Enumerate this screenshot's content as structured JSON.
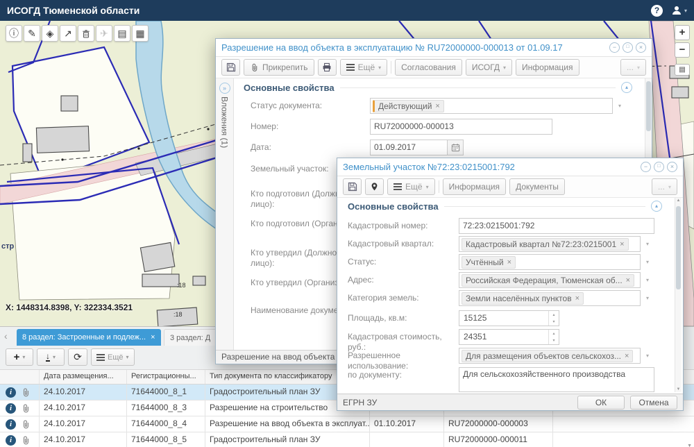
{
  "colors": {
    "topbar_bg": "#1e3c5c",
    "accent_blue": "#3e9bd6",
    "dialog_title_blue": "#4191c9",
    "selected_row": "#d2e9f8",
    "status_tag_accent": "#e9a13c"
  },
  "glyphs": {
    "help": "?",
    "chevron_down": "▾",
    "chevron_up": "▴",
    "chevron_left": "‹",
    "minimize": "−",
    "maximize": "□",
    "close": "×",
    "plus": "+",
    "down_arrow": "↓",
    "refresh": "⟳",
    "spin_up": "▴",
    "spin_down": "▾",
    "scroll_up": "▲",
    "scroll_down": "▼",
    "expand_right": "»",
    "info_letter": "i"
  },
  "app": {
    "title": "ИСОГД Тюменской области"
  },
  "map": {
    "coordinates": "X: 1448314.8398, Y: 322334.3521",
    "labels": {
      "parcel_a": ":18",
      "parcel_b": ":18",
      "street": "стр"
    },
    "zoom_in": "+",
    "zoom_out": "−",
    "basemap_glyph": "▤"
  },
  "map_toolbar": {
    "icons": [
      {
        "name": "info",
        "glyph": "ⓘ"
      },
      {
        "name": "edit",
        "glyph": "✎"
      },
      {
        "name": "geometry",
        "glyph": "◈"
      },
      {
        "name": "export",
        "glyph": "↗"
      },
      {
        "name": "measure",
        "glyph": "✈"
      },
      {
        "name": "layers",
        "glyph": "▤"
      },
      {
        "name": "legend",
        "glyph": "▦"
      }
    ]
  },
  "dialog1": {
    "title": "Разрешение на ввод объекта в эксплуатацию № RU72000000-000013 от 01.09.17",
    "toolbar": {
      "attach": "Прикрепить",
      "more": "Ещё",
      "approvals": "Согласования",
      "isogd": "ИСОГД",
      "info": "Информация",
      "overflow": "..."
    },
    "attachments_tab": "Вложения (1)",
    "section_title": "Основные свойства",
    "fields": {
      "status": {
        "label": "Статус документа:",
        "tag": "Действующий"
      },
      "number": {
        "label": "Номер:",
        "value": "RU72000000-000013"
      },
      "date": {
        "label": "Дата:",
        "value": "01.09.2017"
      },
      "parcel": {
        "label": "Земельный участок:"
      },
      "prepared_by_person": {
        "label": "Кто подготовил (Должностное лицо):"
      },
      "prepared_by_org": {
        "label": "Кто подготовил (Организация):"
      },
      "approved_by_person": {
        "label": "Кто утвердил (Должностное лицо):"
      },
      "approved_by_org": {
        "label": "Кто утвердил (Организация):"
      },
      "doc_name": {
        "label": "Наименование документа:"
      }
    },
    "status_bar": "Разрешение на ввод объекта в эксплуатацию"
  },
  "dialog2": {
    "title": "Земельный участок №72:23:0215001:792",
    "toolbar": {
      "more": "Ещё",
      "info": "Информация",
      "documents": "Документы",
      "overflow": "..."
    },
    "section_title": "Основные свойства",
    "fields": {
      "cad_number": {
        "label": "Кадастровый номер:",
        "value": "72:23:0215001:792"
      },
      "cad_block": {
        "label": "Кадастровый квартал:",
        "tag": "Кадастровый квартал №72:23:0215001"
      },
      "status": {
        "label": "Статус:",
        "tag": "Учтённый"
      },
      "address": {
        "label": "Адрес:",
        "tag": "Российская Федерация, Тюменская об..."
      },
      "land_category": {
        "label": "Категория земель:",
        "tag": "Земли населённых пунктов"
      },
      "area": {
        "label": "Площадь, кв.м:",
        "value": "15125"
      },
      "cad_value": {
        "label": "Кадастровая стоимость, руб.:",
        "value": "24351"
      },
      "permitted_use": {
        "label": "Разрешенное использование:",
        "tag": "Для размещения объектов сельскохоз..."
      },
      "by_document": {
        "label": "по документу:",
        "value": "Для сельскохозяйственного производства"
      }
    },
    "footer": {
      "egrn": "ЕГРН ЗУ",
      "ok": "ОК",
      "cancel": "Отмена"
    }
  },
  "bottom_panel": {
    "tabs": [
      {
        "label": "8 раздел: Застроенные и подлеж...",
        "close": "×"
      },
      {
        "label": "3 раздел: Д"
      }
    ],
    "toolbar": {
      "more": "Ещё"
    },
    "table": {
      "headers": [
        "Дата размещения...",
        "Регистрационны...",
        "Тип документа по классификатору"
      ],
      "rows": [
        {
          "placed": "24.10.2017",
          "reg": "71644000_8_1",
          "doc_type": "Градостроительный план ЗУ",
          "doc_date": "",
          "doc_number": ""
        },
        {
          "placed": "24.10.2017",
          "reg": "71644000_8_3",
          "doc_type": "Разрешение на строительство",
          "doc_date": "",
          "doc_number": ""
        },
        {
          "placed": "24.10.2017",
          "reg": "71644000_8_4",
          "doc_type": "Разрешение на ввод объекта в эксплуат...",
          "doc_date": "01.10.2017",
          "doc_number": "RU72000000-000003"
        },
        {
          "placed": "24.10.2017",
          "reg": "71644000_8_5",
          "doc_type": "Градостроительный план ЗУ",
          "doc_date": "",
          "doc_number": "RU72000000-000011"
        }
      ]
    }
  }
}
